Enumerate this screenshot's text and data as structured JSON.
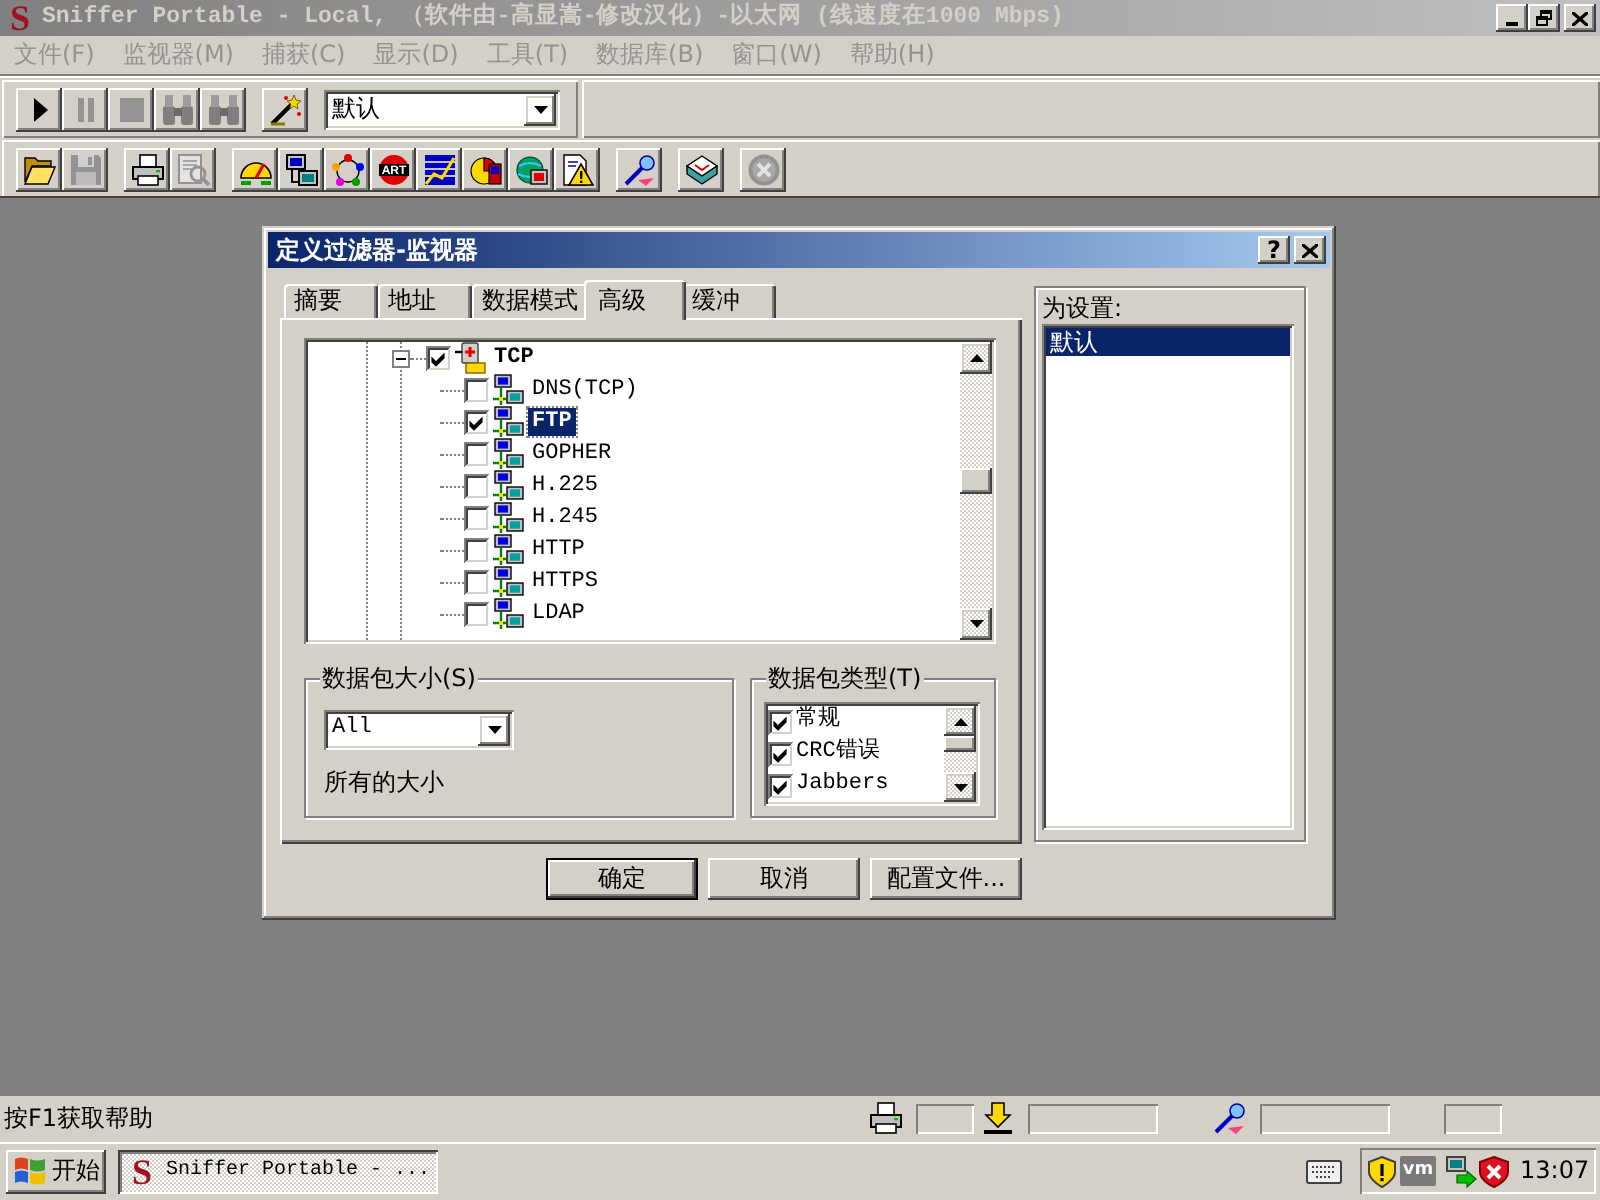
{
  "window": {
    "logo": "S",
    "title": "Sniffer Portable - Local, （软件由-高显嵩-修改汉化）-以太网 (线速度在1000 Mbps)",
    "active": false
  },
  "menu": [
    {
      "label": "文件(F)",
      "disabled": true
    },
    {
      "label": "监视器(M)",
      "disabled": true
    },
    {
      "label": "捕获(C)",
      "disabled": true
    },
    {
      "label": "显示(D)",
      "disabled": true
    },
    {
      "label": "工具(T)",
      "disabled": true
    },
    {
      "label": "数据库(B)",
      "disabled": true
    },
    {
      "label": "窗口(W)",
      "disabled": true
    },
    {
      "label": "帮助(H)",
      "disabled": true
    }
  ],
  "toolbar_1": {
    "buttons": [
      {
        "kind": "play",
        "disabled": false
      },
      {
        "kind": "pause",
        "disabled": true
      },
      {
        "kind": "stop",
        "disabled": true
      },
      {
        "kind": "binoculars",
        "disabled": true
      },
      {
        "kind": "binoculars",
        "disabled": true
      },
      {
        "kind": "separator"
      },
      {
        "kind": "wand",
        "disabled": false
      }
    ],
    "profile_select": {
      "value": "默认"
    }
  },
  "toolbar_2": {
    "buttons": [
      {
        "kind": "open",
        "disabled": false
      },
      {
        "kind": "save",
        "disabled": true
      },
      {
        "kind": "separator"
      },
      {
        "kind": "print",
        "disabled": false
      },
      {
        "kind": "print_preview",
        "disabled": true
      },
      {
        "kind": "separator"
      },
      {
        "kind": "gauge",
        "disabled": false
      },
      {
        "kind": "computers",
        "disabled": false
      },
      {
        "kind": "node_ring",
        "disabled": false
      },
      {
        "kind": "art",
        "disabled": false,
        "text": "ART"
      },
      {
        "kind": "line_chart",
        "disabled": false
      },
      {
        "kind": "pie",
        "disabled": false
      },
      {
        "kind": "globe",
        "disabled": false
      },
      {
        "kind": "warning",
        "disabled": false
      },
      {
        "kind": "separator"
      },
      {
        "kind": "probe",
        "disabled": false
      },
      {
        "kind": "separator"
      },
      {
        "kind": "box",
        "disabled": false
      },
      {
        "kind": "separator"
      },
      {
        "kind": "cancel",
        "disabled": true
      }
    ]
  },
  "dialog": {
    "title": "定义过滤器-监视器",
    "active": true,
    "help": "?",
    "tabs": [
      {
        "label": "摘要",
        "selected": false
      },
      {
        "label": "地址",
        "selected": false
      },
      {
        "label": "数据模式",
        "selected": false
      },
      {
        "label": "高级",
        "selected": true
      },
      {
        "label": "缓冲",
        "selected": false
      }
    ],
    "protocol_tree": [
      {
        "label": "TCP",
        "checked": true,
        "expanded": true,
        "selected": false,
        "children": [
          {
            "label": "DNS(TCP)",
            "checked": false,
            "selected": false
          },
          {
            "label": "FTP",
            "checked": true,
            "selected": true
          },
          {
            "label": "GOPHER",
            "checked": false,
            "selected": false
          },
          {
            "label": "H.225",
            "checked": false,
            "selected": false
          },
          {
            "label": "H.245",
            "checked": false,
            "selected": false
          },
          {
            "label": "HTTP",
            "checked": false,
            "selected": false
          },
          {
            "label": "HTTPS",
            "checked": false,
            "selected": false
          },
          {
            "label": "LDAP",
            "checked": false,
            "selected": false
          }
        ]
      }
    ],
    "packet_size": {
      "title": "数据包大小(S)",
      "value": "All",
      "note": "所有的大小"
    },
    "packet_type": {
      "title": "数据包类型(T)",
      "items": [
        {
          "label": "常规",
          "checked": true
        },
        {
          "label": "CRC错误",
          "checked": true
        },
        {
          "label": "Jabbers",
          "checked": true
        }
      ]
    },
    "settings_for": {
      "title": "为设置:",
      "items": [
        {
          "label": "默认",
          "selected": true
        }
      ]
    },
    "buttons": [
      {
        "label": "确定",
        "default": true
      },
      {
        "label": "取消",
        "default": false
      },
      {
        "label": "配置文件...",
        "default": false
      }
    ]
  },
  "status_bar": {
    "text": "按F1获取帮助"
  },
  "taskbar": {
    "start": "开始",
    "tasks": [
      {
        "logo": "S",
        "label": "Sniffer Portable - ...",
        "selected": true
      }
    ],
    "tray_badge": "vm",
    "clock": "13:07"
  }
}
